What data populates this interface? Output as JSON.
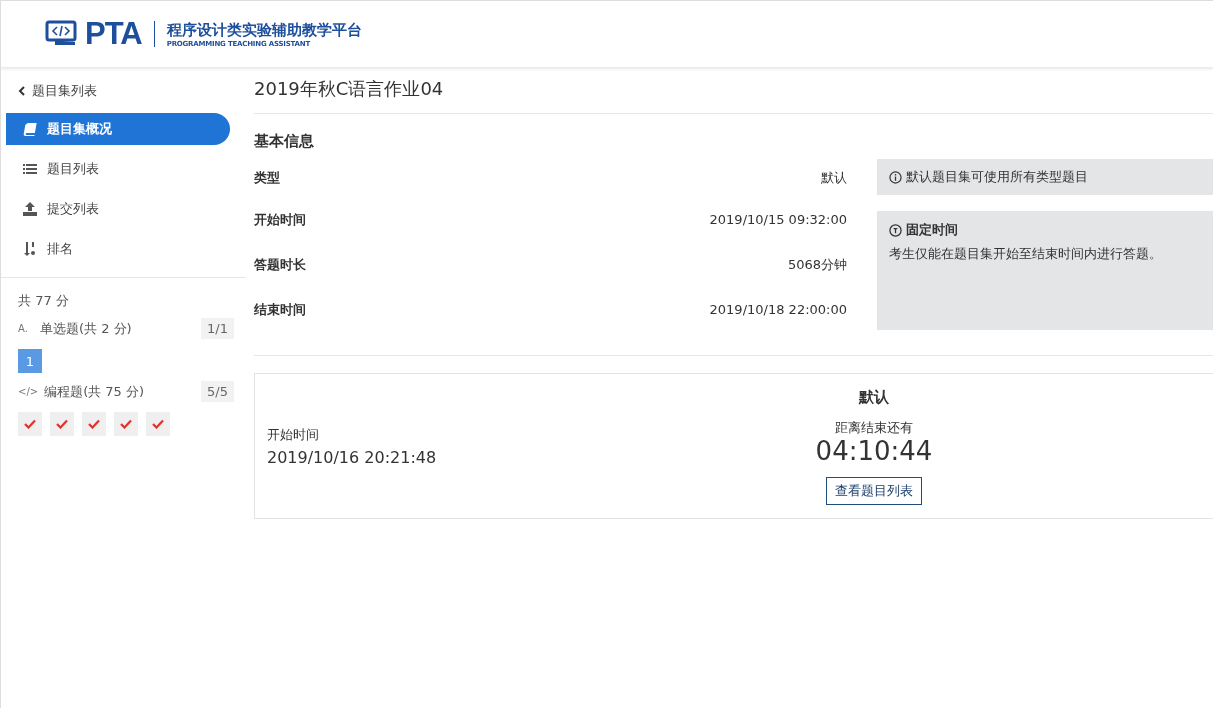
{
  "header": {
    "logo_text": "PTA",
    "logo_title": "程序设计类实验辅助教学平台",
    "logo_subtitle": "PROGRAMMING TEACHING ASSISTANT"
  },
  "sidebar": {
    "back": "题目集列表",
    "items": [
      {
        "label": "题目集概况",
        "selected": true
      },
      {
        "label": "题目列表",
        "selected": false
      },
      {
        "label": "提交列表",
        "selected": false
      },
      {
        "label": "排名",
        "selected": false
      }
    ],
    "total": "共 77 分",
    "groups": [
      {
        "icon": "A.",
        "title": "单选题(共 2 分)",
        "count": "1/1",
        "problems": [
          {
            "kind": "number",
            "label": "1"
          }
        ]
      },
      {
        "icon": "</>",
        "title": "编程题(共 75 分)",
        "count": "5/5",
        "problems": [
          {
            "kind": "check"
          },
          {
            "kind": "check"
          },
          {
            "kind": "check"
          },
          {
            "kind": "check"
          },
          {
            "kind": "check"
          }
        ]
      }
    ]
  },
  "main": {
    "title": "2019年秋C语言作业04",
    "section": "基本信息",
    "rows": [
      {
        "label": "类型",
        "value": "默认"
      },
      {
        "label": "开始时间",
        "value": "2019/10/15 09:32:00"
      },
      {
        "label": "答题时长",
        "value": "5068分钟"
      },
      {
        "label": "结束时间",
        "value": "2019/10/18 22:00:00"
      }
    ],
    "type_note": "默认题目集可使用所有类型题目",
    "time_note": {
      "title": "固定时间",
      "text": "考生仅能在题目集开始至结束时间内进行答题。"
    },
    "card": {
      "start_label": "开始时间",
      "start_value": "2019/10/16 20:21:48",
      "mode": "默认",
      "remain_label": "距离结束还有",
      "remain": "04:10:44",
      "button": "查看题目列表"
    }
  }
}
